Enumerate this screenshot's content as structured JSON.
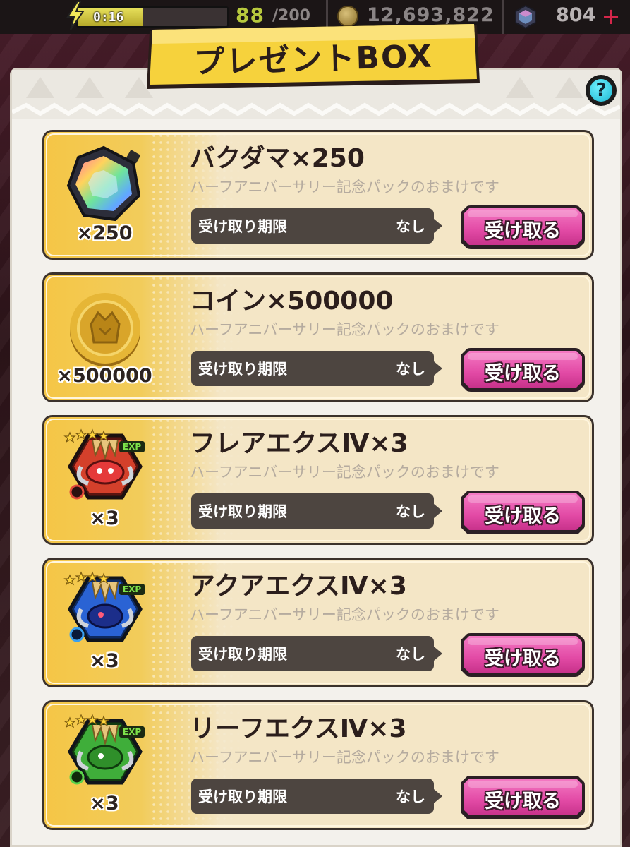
{
  "status": {
    "stamina_timer": "0:16",
    "stamina_current": "88",
    "stamina_max": "/200",
    "stamina_fill": 0.44,
    "coins": "12,693,822",
    "gems": "804",
    "add_icon": "plus-icon"
  },
  "header": {
    "title": "プレゼントBOX",
    "help_label": "?"
  },
  "colors": {
    "banner_yellow": "#f6d23c",
    "button_pink": "#e24aa5",
    "deadline_bg": "#4d4540",
    "item_bg": "#f4e6c6"
  },
  "items": [
    {
      "icon": "rainbow-gem-icon",
      "title": "バクダマ×250",
      "desc": "ハーフアニバーサリー記念パックのおまけです",
      "qty": "×250",
      "deadline_label": "受け取り期限",
      "deadline_value": "なし",
      "button": "受け取る"
    },
    {
      "icon": "gold-coin-icon",
      "title": "コイン×500000",
      "desc": "ハーフアニバーサリー記念パックのおまけです",
      "qty": "×500000",
      "deadline_label": "受け取り期限",
      "deadline_value": "なし",
      "button": "受け取る"
    },
    {
      "icon": "flare-ex-character-icon",
      "badge": "EXP",
      "title": "フレアエクスⅣ×3",
      "desc": "ハーフアニバーサリー記念パックのおまけです",
      "qty": "×3",
      "deadline_label": "受け取り期限",
      "deadline_value": "なし",
      "button": "受け取る"
    },
    {
      "icon": "aqua-ex-character-icon",
      "badge": "EXP",
      "title": "アクアエクスⅣ×3",
      "desc": "ハーフアニバーサリー記念パックのおまけです",
      "qty": "×3",
      "deadline_label": "受け取り期限",
      "deadline_value": "なし",
      "button": "受け取る"
    },
    {
      "icon": "leaf-ex-character-icon",
      "badge": "EXP",
      "title": "リーフエクスⅣ×3",
      "desc": "ハーフアニバーサリー記念パックのおまけです",
      "qty": "×3",
      "deadline_label": "受け取り期限",
      "deadline_value": "なし",
      "button": "受け取る"
    }
  ]
}
